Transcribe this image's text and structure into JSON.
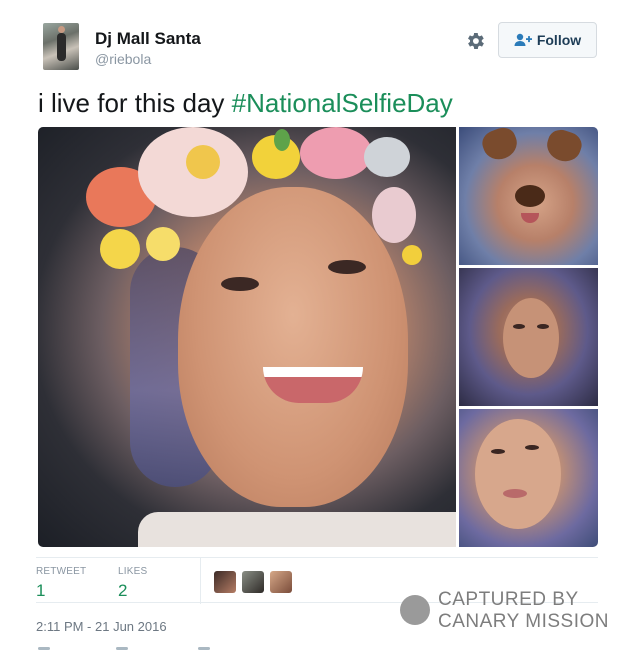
{
  "user": {
    "display_name": "Dj Mall Santa",
    "handle": "@riebola",
    "avatar_icon": "profile-photo"
  },
  "header": {
    "settings_icon": "gear-icon",
    "follow_label": "Follow",
    "follow_icon": "add-user-icon"
  },
  "tweet": {
    "text_plain": "i live for this day ",
    "hashtag": "#NationalSelfieDay"
  },
  "media": {
    "photos": [
      "main-selfie-photo",
      "dog-filter-selfie-photo",
      "selfie-photo-2",
      "selfie-photo-3"
    ]
  },
  "stats": {
    "retweets_label": "RETWEET",
    "retweets_value": "1",
    "likes_label": "LIKES",
    "likes_value": "2",
    "likers": [
      "liker-avatar-1",
      "liker-avatar-2",
      "liker-avatar-3"
    ]
  },
  "timestamp": "2:11 PM - 21 Jun 2016",
  "watermark": {
    "line1": "CAPTURED BY",
    "line2": "CANARY MISSION"
  },
  "colors": {
    "hashtag": "#1b8e5a",
    "count": "#1b8e5a",
    "follow_text": "#1d3c56",
    "muted": "#8a96a2"
  }
}
